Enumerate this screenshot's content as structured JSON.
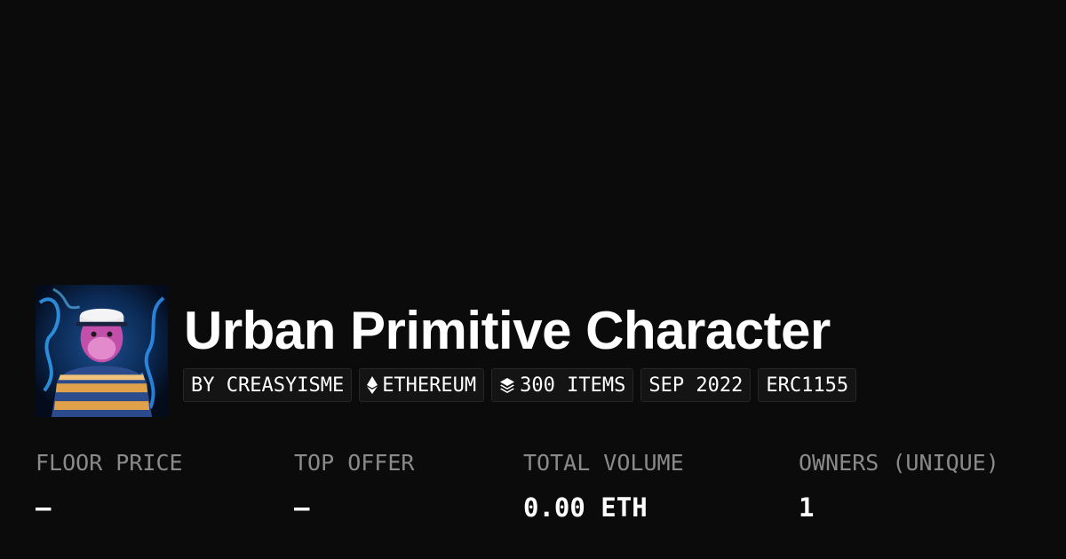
{
  "collection": {
    "title": "Urban Primitive Character",
    "avatar_alt": "collection-avatar"
  },
  "tags": {
    "creator": "BY CREASYISME",
    "chain": "ETHEREUM",
    "items": "300 ITEMS",
    "date": "SEP 2022",
    "standard": "ERC1155"
  },
  "icons": {
    "chain": "ethereum-icon",
    "items": "layers-icon"
  },
  "stats": [
    {
      "label": "FLOOR PRICE",
      "value": "—"
    },
    {
      "label": "TOP OFFER",
      "value": "—"
    },
    {
      "label": "TOTAL VOLUME",
      "value": "0.00 ETH"
    },
    {
      "label": "OWNERS (UNIQUE)",
      "value": "1"
    }
  ],
  "colors": {
    "background": "#0b0b0b",
    "tag_background": "#141414",
    "label": "#8a8a8a",
    "text": "#ffffff"
  }
}
